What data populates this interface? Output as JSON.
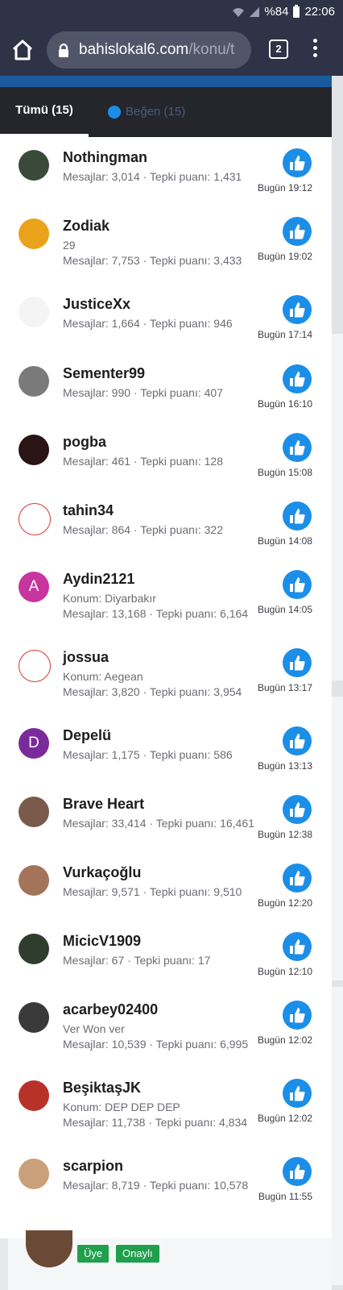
{
  "status_bar": {
    "battery": "%84",
    "time": "22:06"
  },
  "browser": {
    "url_host": "bahislokal6.com",
    "url_path": "/konu/t",
    "tab_count": "2"
  },
  "tabs": {
    "all_label": "Tümü (15)",
    "like_label": "Beğen (15)"
  },
  "reactions": [
    {
      "name": "Nothingman",
      "extra": "",
      "stats": "Mesajlar: 3,014 · Tepki puanı: 1,431",
      "time": "Bugün 19:12",
      "avatar_letter": "",
      "avatar_color": "#3a4a3a"
    },
    {
      "name": "Zodiak",
      "extra": "29",
      "stats": "Mesajlar: 7,753 · Tepki puanı: 3,433",
      "time": "Bugün 19:02",
      "avatar_letter": "",
      "avatar_color": "#e9a21a"
    },
    {
      "name": "JusticeXx",
      "extra": "",
      "stats": "Mesajlar: 1,664 · Tepki puanı: 946",
      "time": "Bugün 17:14",
      "avatar_letter": "",
      "avatar_color": "#f4f4f4"
    },
    {
      "name": "Sementer99",
      "extra": "",
      "stats": "Mesajlar: 990 · Tepki puanı: 407",
      "time": "Bugün 16:10",
      "avatar_letter": "",
      "avatar_color": "#7a7a7a"
    },
    {
      "name": "pogba",
      "extra": "",
      "stats": "Mesajlar: 461 · Tepki puanı: 128",
      "time": "Bugün 15:08",
      "avatar_letter": "",
      "avatar_color": "#2a1416"
    },
    {
      "name": "tahin34",
      "extra": "",
      "stats": "Mesajlar: 864 · Tepki puanı: 322",
      "time": "Bugün 14:08",
      "avatar_letter": "",
      "avatar_color": "#ffffff"
    },
    {
      "name": "Aydin2121",
      "extra": "Konum: Diyarbakır",
      "stats": "Mesajlar: 13,168 · Tepki puanı: 6,164",
      "time": "Bugün 14:05",
      "avatar_letter": "A",
      "avatar_color": "#c8359e"
    },
    {
      "name": "jossua",
      "extra": "Konum: Aegean",
      "stats": "Mesajlar: 3,820 · Tepki puanı: 3,954",
      "time": "Bugün 13:17",
      "avatar_letter": "",
      "avatar_color": "#ffffff"
    },
    {
      "name": "Depelü",
      "extra": "",
      "stats": "Mesajlar: 1,175 · Tepki puanı: 586",
      "time": "Bugün 13:13",
      "avatar_letter": "D",
      "avatar_color": "#7a2a9a"
    },
    {
      "name": "Brave Heart",
      "extra": "",
      "stats": "Mesajlar: 33,414 · Tepki puanı: 16,461",
      "time": "Bugün 12:38",
      "avatar_letter": "",
      "avatar_color": "#7a5a4a"
    },
    {
      "name": "Vurkaçoğlu",
      "extra": "",
      "stats": "Mesajlar: 9,571 · Tepki puanı: 9,510",
      "time": "Bugün 12:20",
      "avatar_letter": "",
      "avatar_color": "#a4745a"
    },
    {
      "name": "MicicV1909",
      "extra": "",
      "stats": "Mesajlar: 67 · Tepki puanı: 17",
      "time": "Bugün 12:10",
      "avatar_letter": "",
      "avatar_color": "#2f3d2f"
    },
    {
      "name": "acarbey02400",
      "extra": "Ver Won ver",
      "stats": "Mesajlar: 10,539 · Tepki puanı: 6,995",
      "time": "Bugün 12:02",
      "avatar_letter": "",
      "avatar_color": "#3a3a3a"
    },
    {
      "name": "BeşiktaşJK",
      "extra": "Konum: DEP DEP DEP",
      "stats": "Mesajlar: 11,738 · Tepki puanı: 4,834",
      "time": "Bugün 12:02",
      "avatar_letter": "",
      "avatar_color": "#b8322a"
    },
    {
      "name": "scarpion",
      "extra": "",
      "stats": "Mesajlar: 8,719 · Tepki puanı: 10,578",
      "time": "Bugün 11:55",
      "avatar_letter": "",
      "avatar_color": "#c9a07a"
    }
  ],
  "footer_badges": {
    "member": "Üye",
    "verified": "Onaylı"
  },
  "colors": {
    "like_blue": "#1b8ee8",
    "topbar": "#2f3347",
    "accent_strip": "#185a9d",
    "badge_green": "#20a04c"
  }
}
